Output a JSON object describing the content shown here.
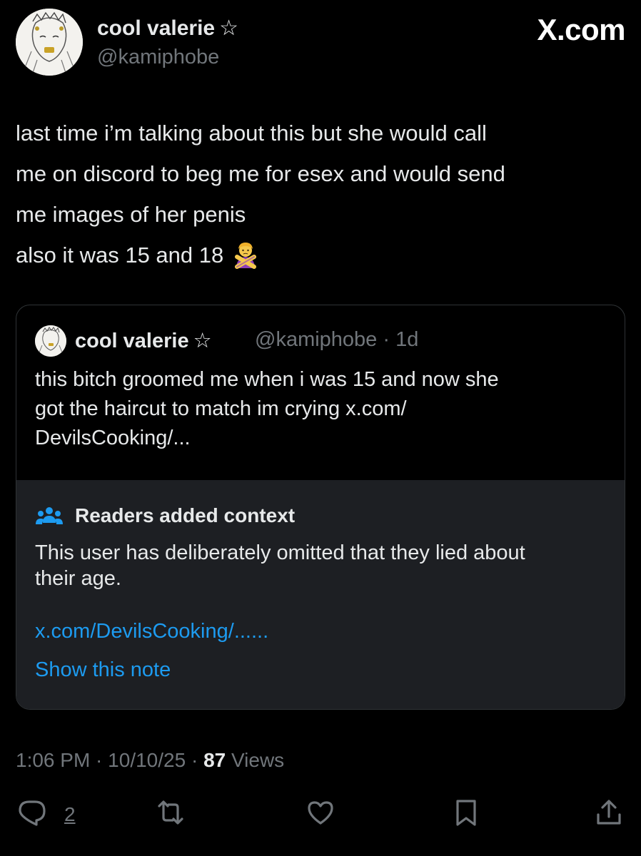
{
  "author": {
    "display_name": "cool valerie",
    "badge_glyph": "☆",
    "handle": "@kamiphobe"
  },
  "brand": {
    "label": "X.com"
  },
  "tweet": {
    "lines": [
      "last time i’m talking about this but she would call",
      "me on discord to beg me for esex and would send",
      "me images of her penis",
      "also it was 15 and 18"
    ],
    "emoji": "person-gesturing-no-emoji"
  },
  "quote": {
    "display_name": "cool valerie",
    "badge_glyph": "☆",
    "handle_time": "@kamiphobe · 1d",
    "lines": [
      "this bitch groomed me when i was 15 and now she",
      "got the haircut to match im crying x.com/",
      "DevilsCooking/..."
    ]
  },
  "note": {
    "icon": "people-icon",
    "title": "Readers added context",
    "lines": [
      "This user has deliberately omitted that they lied about",
      "their age."
    ],
    "link": "x.com/DevilsCooking/......",
    "show_label": "Show this note"
  },
  "meta": {
    "time": "1:06 PM",
    "separator": " · ",
    "date": "10/10/25",
    "views_count": "87",
    "views_label": " Views"
  },
  "actions": {
    "reply_count": "2",
    "icons": [
      "reply-icon",
      "repost-icon",
      "like-icon",
      "bookmark-icon",
      "share-icon"
    ]
  },
  "colors": {
    "background": "#000000",
    "text": "#e7e9ea",
    "muted": "#71767b",
    "link": "#1d9bf0",
    "note_bg": "#1d1f23",
    "border": "#2f3336"
  }
}
